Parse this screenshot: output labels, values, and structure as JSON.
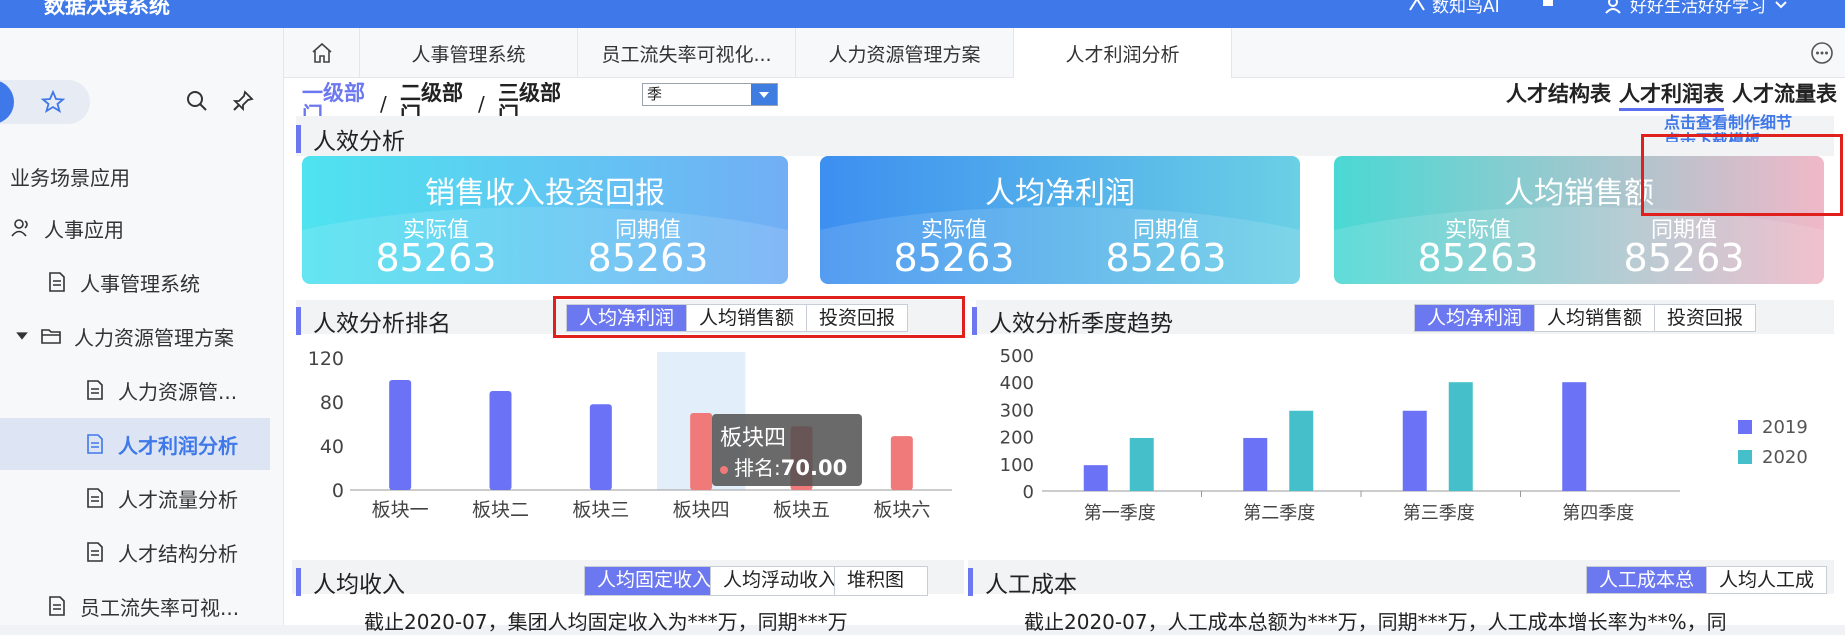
{
  "app": {
    "title": "数据决策系统",
    "ai_label": "数知鸟AI",
    "user_name": "好好生活好好学习"
  },
  "sidebar": {
    "group_label": "业务场景应用",
    "items": [
      {
        "label": "人事应用",
        "icon": "users-icon"
      },
      {
        "label": "人事管理系统",
        "icon": "document-icon"
      },
      {
        "label": "人力资源管理方案",
        "icon": "folder-icon"
      },
      {
        "label": "人力资源管...",
        "icon": "document-icon"
      },
      {
        "label": "人才利润分析",
        "icon": "document-icon"
      },
      {
        "label": "人才流量分析",
        "icon": "document-icon"
      },
      {
        "label": "人才结构分析",
        "icon": "document-icon"
      },
      {
        "label": "员工流失率可视...",
        "icon": "document-icon"
      }
    ]
  },
  "tabs": [
    "人事管理系统",
    "员工流失率可视化...",
    "人力资源管理方案",
    "人才利润分析"
  ],
  "breadcrumb": [
    "一级部门",
    "二级部门",
    "三级部门"
  ],
  "period_select": "季",
  "report_tabs": [
    "人才结构表",
    "人才利润表",
    "人才流量表"
  ],
  "links": {
    "view_detail": "点击查看制作细节",
    "download_template": "点击下载模板"
  },
  "efficiency": {
    "title": "人效分析",
    "actual_label": "实际值",
    "prev_label": "同期值",
    "cards": [
      {
        "title": "销售收入投资回报",
        "actual": "85263",
        "prev": "85263"
      },
      {
        "title": "人均净利润",
        "actual": "85263",
        "prev": "85263"
      },
      {
        "title": "人均销售额",
        "actual": "85263",
        "prev": "85263"
      }
    ]
  },
  "ranking": {
    "title": "人效分析排名",
    "seg": [
      "人均净利润",
      "人均销售额",
      "投资回报"
    ],
    "tooltip_title": "板块四",
    "tooltip_label": "排名:",
    "tooltip_value": "70.00"
  },
  "trend": {
    "title": "人效分析季度趋势",
    "seg": [
      "人均净利润",
      "人均销售额",
      "投资回报"
    ]
  },
  "income": {
    "title": "人均收入",
    "seg": [
      "人均固定收入",
      "人均浮动收入",
      "堆积图"
    ],
    "note": "截止2020-07，集团人均固定收入为***万，同期***万"
  },
  "cost": {
    "title": "人工成本",
    "seg": [
      "人工成本总",
      "人均人工成"
    ],
    "note": "截止2020-07，人工成本总额为***万，同期***万，人工成本增长率为**%，同"
  },
  "colors": {
    "accent": "#6b78f0",
    "series_2019": "#6b72f5",
    "series_2020": "#45c0ca",
    "highlight_bar": "#f07a7a"
  },
  "chart_data": [
    {
      "type": "bar",
      "categories": [
        "板块一",
        "板块二",
        "板块三",
        "板块四",
        "板块五",
        "板块六"
      ],
      "values": [
        100,
        90,
        78,
        70,
        58,
        49
      ],
      "ylim": [
        0,
        120
      ],
      "yticks": [
        0,
        40,
        80,
        120
      ],
      "highlight": [
        "板块四",
        "板块五",
        "板块六"
      ],
      "grid": false
    },
    {
      "type": "bar",
      "categories": [
        "第一季度",
        "第二季度",
        "第三季度",
        "第四季度"
      ],
      "series": [
        {
          "name": "2019",
          "values": [
            95,
            195,
            295,
            400
          ]
        },
        {
          "name": "2020",
          "values": [
            195,
            295,
            400,
            0
          ]
        }
      ],
      "ylim": [
        0,
        500
      ],
      "yticks": [
        0,
        100,
        200,
        300,
        400,
        500
      ],
      "legend": "right"
    }
  ]
}
